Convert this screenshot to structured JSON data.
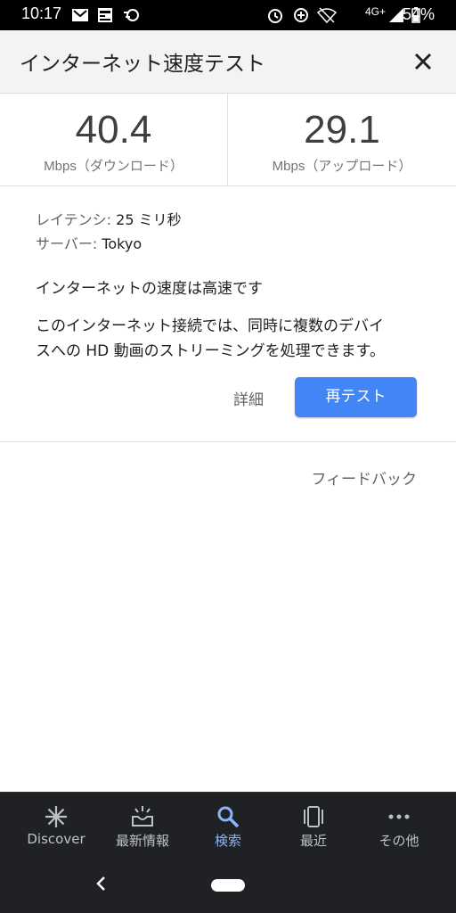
{
  "status_bar": {
    "time": "10:17",
    "network": "4G+",
    "battery": "54%"
  },
  "header": {
    "title": "インターネット速度テスト"
  },
  "results": {
    "download_value": "40.4",
    "download_label": "Mbps（ダウンロード）",
    "upload_value": "29.1",
    "upload_label": "Mbps（アップロード）"
  },
  "info": {
    "latency_key": "レイテンシ: ",
    "latency_value": "25 ミリ秒",
    "server_key": "サーバー: ",
    "server_value": "Tokyo",
    "status_message": "インターネットの速度は高速です",
    "description_line1": "このインターネット接続では、同時に複数のデバイ",
    "description_line2": "スへの HD 動画のストリーミングを処理できます。"
  },
  "actions": {
    "details_label": "詳細",
    "retest_label": "再テスト",
    "feedback_label": "フィードバック"
  },
  "bottom_nav": {
    "items": [
      {
        "label": "Discover",
        "icon": "asterisk-icon"
      },
      {
        "label": "最新情報",
        "icon": "updates-inbox-icon"
      },
      {
        "label": "検索",
        "icon": "search-icon"
      },
      {
        "label": "最近",
        "icon": "recent-cards-icon"
      },
      {
        "label": "その他",
        "icon": "more-dots-icon"
      }
    ],
    "active_index": 2
  },
  "colors": {
    "accent": "#4285f4",
    "active_nav": "#8ab4f8",
    "nav_bg": "#202124"
  }
}
